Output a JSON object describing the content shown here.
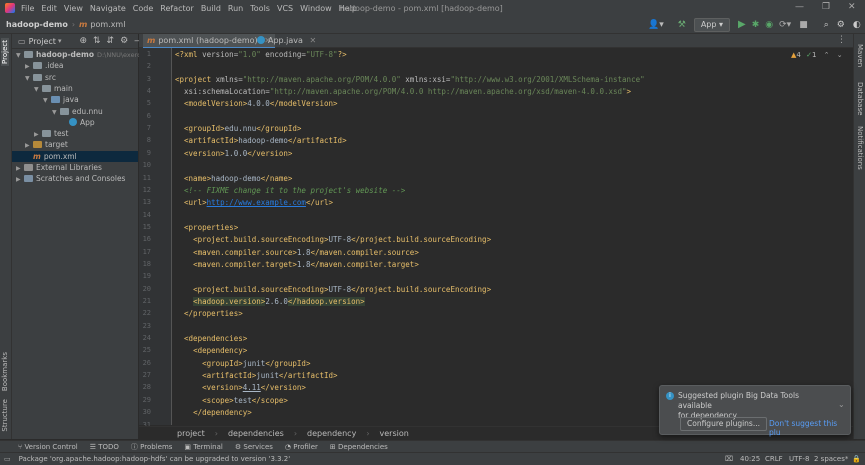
{
  "menu": [
    "File",
    "Edit",
    "View",
    "Navigate",
    "Code",
    "Refactor",
    "Build",
    "Run",
    "Tools",
    "VCS",
    "Window",
    "Help"
  ],
  "window_title": "hadoop-demo - pom.xml [hadoop-demo]",
  "nav": {
    "project": "hadoop-demo",
    "file": "pom.xml"
  },
  "run_config": "App",
  "project_panel": {
    "title": "Project",
    "tree": [
      {
        "label": "hadoop-demo",
        "extra": "D:\\NNU\\exerci",
        "indent": 0,
        "kind": "folder",
        "open": true,
        "bold": true
      },
      {
        "label": ".idea",
        "indent": 1,
        "kind": "folder",
        "open": false
      },
      {
        "label": "src",
        "indent": 1,
        "kind": "folder",
        "open": true
      },
      {
        "label": "main",
        "indent": 2,
        "kind": "folder",
        "open": true
      },
      {
        "label": "java",
        "indent": 3,
        "kind": "src",
        "open": true
      },
      {
        "label": "edu.nnu",
        "indent": 4,
        "kind": "folder",
        "open": true
      },
      {
        "label": "App",
        "indent": 5,
        "kind": "class"
      },
      {
        "label": "test",
        "indent": 2,
        "kind": "folder",
        "open": false
      },
      {
        "label": "target",
        "indent": 1,
        "kind": "target",
        "open": false
      },
      {
        "label": "pom.xml",
        "indent": 1,
        "kind": "maven",
        "selected": true
      },
      {
        "label": "External Libraries",
        "indent": 0,
        "kind": "lib",
        "open": false
      },
      {
        "label": "Scratches and Consoles",
        "indent": 0,
        "kind": "scratch",
        "open": false
      }
    ]
  },
  "tabs": [
    {
      "label": "pom.xml (hadoop-demo)",
      "active": true
    },
    {
      "label": "App.java",
      "active": false
    }
  ],
  "inspections": {
    "warnings": "4",
    "ok": "1"
  },
  "code_lines": [
    {
      "n": "1",
      "html": "<span class='tag'>&lt;?xml </span><span class='attr'>version=</span><span class='str'>\"1.0\"</span><span class='attr'> encoding=</span><span class='str'>\"UTF-8\"</span><span class='tag'>?&gt;</span>"
    },
    {
      "n": "2",
      "html": ""
    },
    {
      "n": "3",
      "html": "<span class='tag'>&lt;project </span><span class='attr'>xmlns=</span><span class='str'>\"http://maven.apache.org/POM/4.0.0\"</span><span class='attr'> xmlns:xsi=</span><span class='str'>\"http://www.w3.org/2001/XMLSchema-instance\"</span>"
    },
    {
      "n": "4",
      "html": "  <span class='attr'>xsi:schemaLocation=</span><span class='str'>\"http://maven.apache.org/POM/4.0.0 http://maven.apache.org/xsd/maven-4.0.0.xsd\"</span><span class='tag'>&gt;</span>"
    },
    {
      "n": "5",
      "html": "  <span class='tag'>&lt;modelVersion&gt;</span>4.0.0<span class='tag'>&lt;/modelVersion&gt;</span>"
    },
    {
      "n": "6",
      "html": ""
    },
    {
      "n": "7",
      "html": "  <span class='tag'>&lt;groupId&gt;</span>edu.nnu<span class='tag'>&lt;/groupId&gt;</span>"
    },
    {
      "n": "8",
      "html": "  <span class='tag'>&lt;artifactId&gt;</span>hadoop-demo<span class='tag'>&lt;/artifactId&gt;</span>"
    },
    {
      "n": "9",
      "html": "  <span class='tag'>&lt;version&gt;</span>1.0.0<span class='tag'>&lt;/version&gt;</span>"
    },
    {
      "n": "10",
      "html": ""
    },
    {
      "n": "11",
      "html": "  <span class='tag'>&lt;name&gt;</span>hadoop-demo<span class='tag'>&lt;/name&gt;</span>"
    },
    {
      "n": "12",
      "html": "  <span class='cmt'>&lt;!-- FIXME change it to the project's website --&gt;</span>"
    },
    {
      "n": "13",
      "html": "  <span class='tag'>&lt;url&gt;</span><span class='url'>http://www.example.com</span><span class='tag'>&lt;/url&gt;</span>"
    },
    {
      "n": "14",
      "html": ""
    },
    {
      "n": "15",
      "html": "  <span class='tag'>&lt;properties&gt;</span>"
    },
    {
      "n": "16",
      "html": "    <span class='tag'>&lt;project.build.sourceEncoding&gt;</span>UTF-8<span class='tag'>&lt;/project.build.sourceEncoding&gt;</span>"
    },
    {
      "n": "17",
      "html": "    <span class='tag'>&lt;maven.compiler.source&gt;</span>1.8<span class='tag'>&lt;/maven.compiler.source&gt;</span>"
    },
    {
      "n": "18",
      "html": "    <span class='tag'>&lt;maven.compiler.target&gt;</span>1.8<span class='tag'>&lt;/maven.compiler.target&gt;</span>"
    },
    {
      "n": "19",
      "html": ""
    },
    {
      "n": "20",
      "html": "    <span class='tag'>&lt;project.build.sourceEncoding&gt;</span>UTF-8<span class='tag'>&lt;/project.build.sourceEncoding&gt;</span>"
    },
    {
      "n": "21",
      "html": "    <span class='tag hl'>&lt;hadoop.version&gt;</span>2.6.0<span class='tag hl'>&lt;/hadoop.version&gt;</span>"
    },
    {
      "n": "22",
      "html": "  <span class='tag'>&lt;/properties&gt;</span>"
    },
    {
      "n": "23",
      "html": ""
    },
    {
      "n": "24",
      "html": "  <span class='tag'>&lt;dependencies&gt;</span>"
    },
    {
      "n": "25",
      "html": "    <span class='tag'>&lt;dependency&gt;</span>"
    },
    {
      "n": "26",
      "html": "      <span class='tag'>&lt;groupId&gt;</span>junit<span class='tag'>&lt;/groupId&gt;</span>"
    },
    {
      "n": "27",
      "html": "      <span class='tag'>&lt;artifactId&gt;</span>junit<span class='tag'>&lt;/artifactId&gt;</span>"
    },
    {
      "n": "28",
      "html": "      <span class='tag'>&lt;version&gt;</span><u>4.11</u><span class='tag'>&lt;/version&gt;</span>"
    },
    {
      "n": "29",
      "html": "      <span class='tag'>&lt;scope&gt;</span>test<span class='tag'>&lt;/scope&gt;</span>"
    },
    {
      "n": "30",
      "html": "    <span class='tag'>&lt;/dependency&gt;</span>"
    },
    {
      "n": "31",
      "html": ""
    }
  ],
  "breadcrumbs": [
    "project",
    "dependencies",
    "dependency",
    "version"
  ],
  "toolwindows": [
    "Version Control",
    "TODO",
    "Problems",
    "Terminal",
    "Services",
    "Profiler",
    "Dependencies"
  ],
  "status": {
    "message": "Package 'org.apache.hadoop:hadoop-hdfs' can be upgraded to version '3.3.2'",
    "position": "40:25",
    "line_sep": "CRLF",
    "encoding": "UTF-8",
    "indent": "2 spaces*"
  },
  "notification": {
    "text1": "Suggested plugin Big Data Tools available",
    "text2": "for dependency...",
    "action": "Configure plugins...",
    "dismiss": "Don't suggest this plu"
  },
  "side_labels": {
    "left_top": "Project",
    "left_bookmarks": "Bookmarks",
    "left_structure": "Structure",
    "right_maven": "Maven",
    "right_database": "Database",
    "right_notifications": "Notifications"
  }
}
